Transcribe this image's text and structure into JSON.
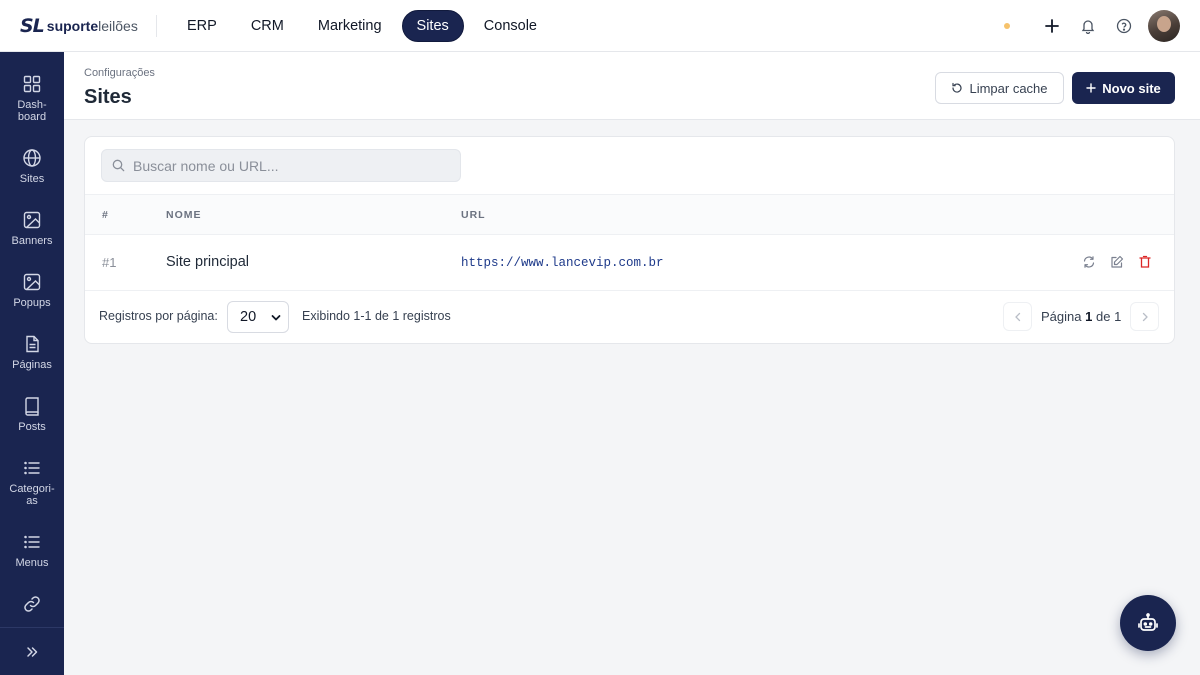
{
  "brand": {
    "mark": "SL",
    "name_bold": "suporte",
    "name_light": "leilões"
  },
  "topnav": {
    "items": [
      {
        "label": "ERP",
        "active": false
      },
      {
        "label": "CRM",
        "active": false
      },
      {
        "label": "Marketing",
        "active": false
      },
      {
        "label": "Sites",
        "active": true
      },
      {
        "label": "Console",
        "active": false
      }
    ]
  },
  "sidebar": {
    "items": [
      {
        "label": "Dash-\nboard",
        "icon": "dashboard-icon"
      },
      {
        "label": "Sites",
        "icon": "globe-icon"
      },
      {
        "label": "Banners",
        "icon": "image-icon"
      },
      {
        "label": "Popups",
        "icon": "image-icon"
      },
      {
        "label": "Páginas",
        "icon": "document-icon"
      },
      {
        "label": "Posts",
        "icon": "book-icon"
      },
      {
        "label": "Categori-\nas",
        "icon": "list-icon"
      },
      {
        "label": "Menus",
        "icon": "list-icon"
      },
      {
        "label": "",
        "icon": "link-icon"
      }
    ]
  },
  "header": {
    "breadcrumb": "Configurações",
    "title": "Sites",
    "clear_cache_label": "Limpar cache",
    "new_site_label": "Novo site"
  },
  "search": {
    "placeholder": "Buscar nome ou URL..."
  },
  "table": {
    "columns": [
      "#",
      "NOME",
      "URL"
    ],
    "rows": [
      {
        "id": "#1",
        "name": "Site principal",
        "url": "https://www.lancevip.com.br"
      }
    ]
  },
  "footer": {
    "per_page_label": "Registros por página:",
    "per_page_value": "20",
    "showing": "Exibindo 1-1 de 1 registros",
    "page_prefix": "Página",
    "page_current": "1",
    "page_of": "de",
    "page_total": "1"
  },
  "colors": {
    "brand": "#1a2550",
    "status_dot": "#f6c26b",
    "danger": "#dc2626",
    "link": "#1e3a8a"
  }
}
